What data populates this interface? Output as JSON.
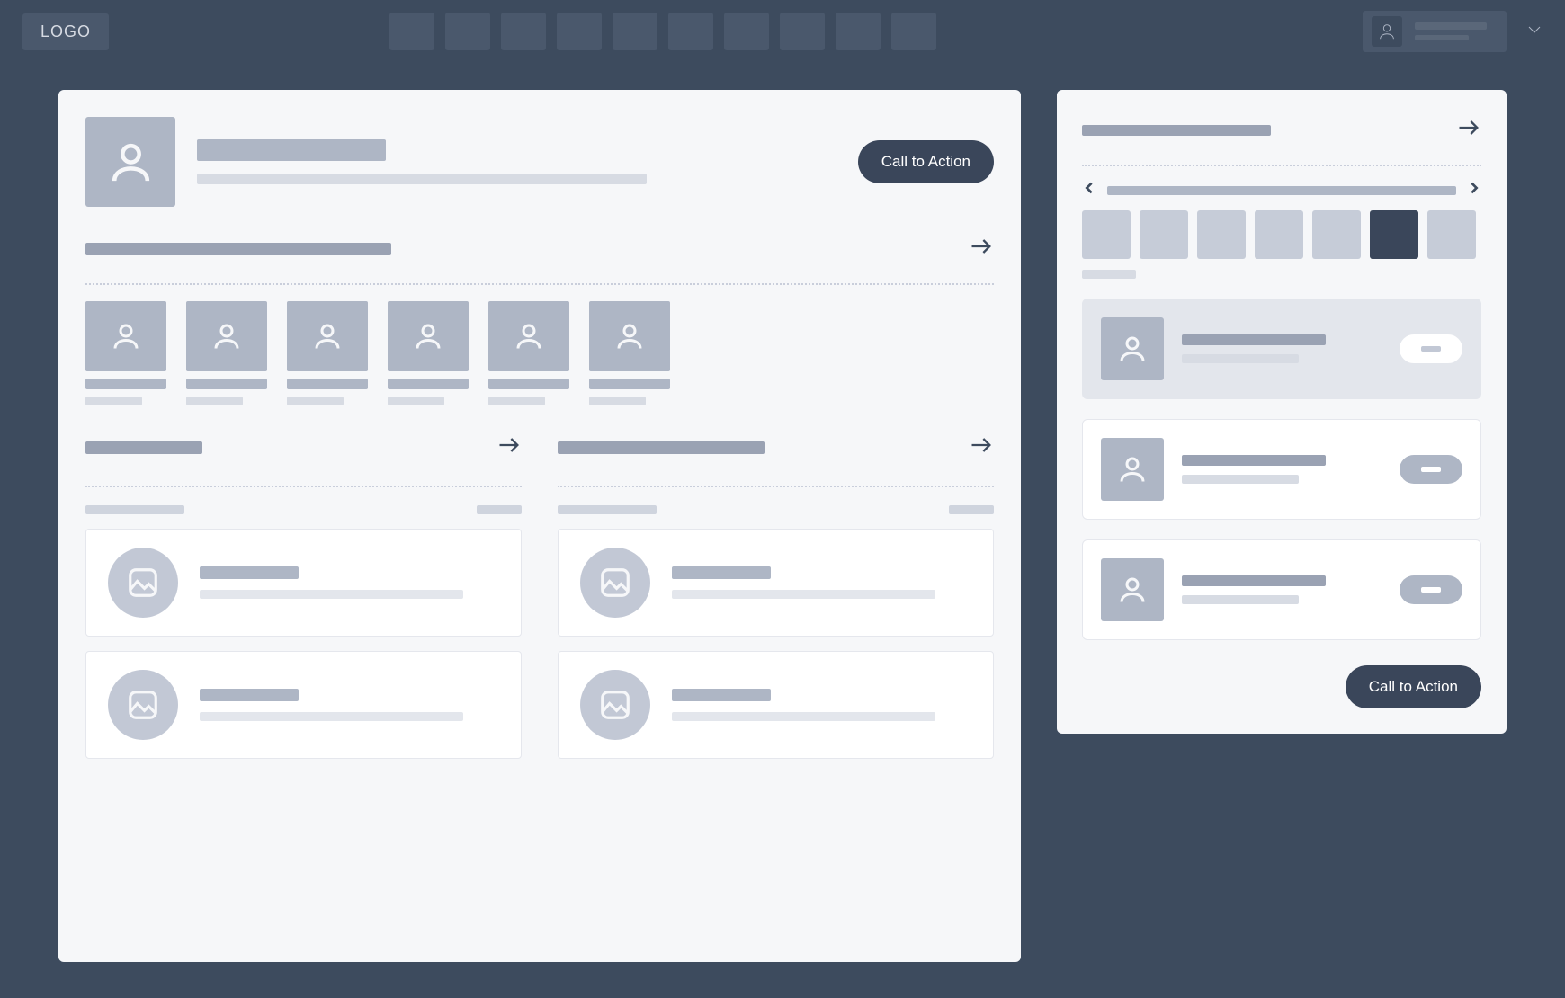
{
  "topbar": {
    "logo": "LOGO",
    "nav_items": [
      "",
      "",
      "",
      "",
      "",
      "",
      "",
      "",
      "",
      ""
    ]
  },
  "hero": {
    "cta_label": "Call to Action"
  },
  "people_section": {
    "count": 6
  },
  "sidebar": {
    "cta_label": "Call to Action",
    "selected_day_index": 5,
    "days": [
      "",
      "",
      "",
      "",
      "",
      "",
      ""
    ],
    "events": [
      {
        "active": true,
        "pill": "white"
      },
      {
        "active": false,
        "pill": "grey"
      },
      {
        "active": false,
        "pill": "grey"
      }
    ]
  }
}
